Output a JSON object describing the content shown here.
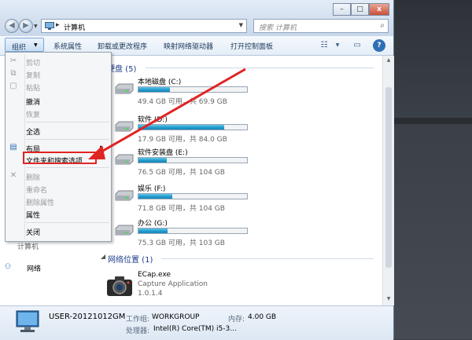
{
  "window": {
    "address": {
      "computer_label": "计算机",
      "chevron": "▸"
    },
    "search": {
      "placeholder": "搜索 计算机"
    },
    "controls": {
      "minimize": "–",
      "maximize": "□",
      "close": "x"
    }
  },
  "toolbar": {
    "organize": "组织",
    "items": [
      "系统属性",
      "卸载或更改程序",
      "映射网络驱动器",
      "打开控制面板"
    ]
  },
  "content": {
    "hdd_section": "硬盘 (5)",
    "drives": [
      {
        "name": "本地磁盘 (C:)",
        "free": "49.4 GB 可用，共 69.9 GB",
        "used_fraction": 0.29
      },
      {
        "name": "软件 (D:)",
        "free": "17.9 GB 可用，共 84.0 GB",
        "used_fraction": 0.79
      },
      {
        "name": "软件安装盘 (E:)",
        "free": "76.5 GB 可用，共 104 GB",
        "used_fraction": 0.26
      },
      {
        "name": "娱乐 (F:)",
        "free": "71.8 GB 可用，共 104 GB",
        "used_fraction": 0.31
      },
      {
        "name": "办公 (G:)",
        "free": "75.3 GB 可用，共 103 GB",
        "used_fraction": 0.27
      }
    ],
    "network_section": "网络位置 (1)",
    "app": {
      "name": "ECap.exe",
      "desc": "Capture Application",
      "version": "1.0.1.4"
    },
    "nav_network": "网络",
    "nav_computer": "计算机"
  },
  "menu": {
    "items": [
      {
        "label": "剪切",
        "enabled": false,
        "icon": "scissors-icon"
      },
      {
        "label": "复制",
        "enabled": false,
        "icon": "copy-icon"
      },
      {
        "label": "粘贴",
        "enabled": false,
        "icon": "paste-icon"
      },
      {
        "label": "撤消",
        "enabled": true
      },
      {
        "label": "恢复",
        "enabled": false
      },
      {
        "label": "全选",
        "enabled": true
      },
      {
        "label": "布局",
        "enabled": true,
        "icon": "layout-icon",
        "submenu": true
      },
      {
        "label": "文件夹和搜索选项",
        "enabled": true,
        "highlighted": true
      },
      {
        "label": "删除",
        "enabled": false,
        "icon": "delete-icon"
      },
      {
        "label": "重命名",
        "enabled": false
      },
      {
        "label": "删除属性",
        "enabled": false
      },
      {
        "label": "属性",
        "enabled": true
      },
      {
        "label": "关闭",
        "enabled": true
      }
    ],
    "submenu_arrow": "▸"
  },
  "details": {
    "computer_name": "USER-20121012GM",
    "workgroup_label": "工作组:",
    "workgroup": "WORKGROUP",
    "memory_label": "内存:",
    "memory": "4.00 GB",
    "processor_label": "处理器:",
    "processor": "Intel(R) Core(TM) i5-3..."
  },
  "colors": {
    "annotation": "#e02424",
    "drive_bar": "#1f97c9",
    "section_heading": "#1e3c8c"
  }
}
